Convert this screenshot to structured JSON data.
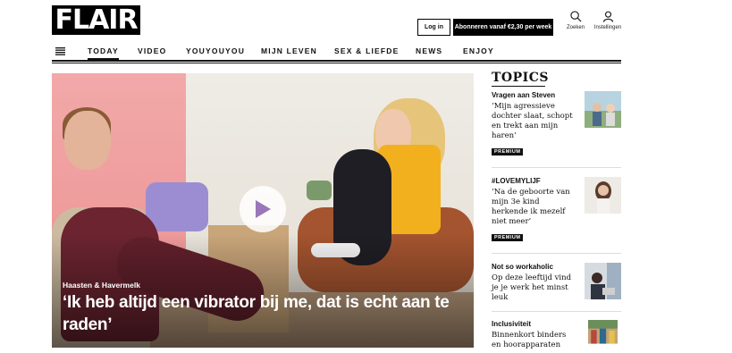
{
  "header": {
    "logo": "FLAIR",
    "login_label": "Log in",
    "subscribe_label": "Abonneren vanaf €2,30 per week",
    "search_label": "Zoeken",
    "settings_label": "Instellingen",
    "search_icon": "search-icon",
    "user_icon": "user-icon"
  },
  "nav": {
    "menu_icon": "hamburger-icon",
    "items": [
      "TODAY",
      "VIDEO",
      "YOUYOUYOU",
      "MIJN LEVEN",
      "SEX & LIEFDE",
      "NEWS",
      "ENJOY"
    ],
    "active": "TODAY"
  },
  "hero": {
    "kicker": "Haasten & Havermelk",
    "headline": "‘Ik heb altijd een vibrator bij me, dat is echt aan te raden’",
    "play_icon": "play-icon"
  },
  "topics": {
    "title": "Topics",
    "items": [
      {
        "kicker": "Vragen aan Steven",
        "title": "‘Mijn agressieve dochter slaat, schopt en trekt aan mijn haren’",
        "badge": "PREMIUM"
      },
      {
        "kicker": "#LOVEMYLIJF",
        "title": "‘Na de geboorte van mijn 3e kind herkende ik mezelf niet meer’",
        "badge": "PREMIUM"
      },
      {
        "kicker": "Not so workaholic",
        "title": "Op deze leeftijd vind je je werk het minst leuk",
        "badge": ""
      },
      {
        "kicker": "Inclusiviteit",
        "title": "Binnenkort binders en hoorapparaten",
        "badge": ""
      }
    ]
  },
  "colors": {
    "brand": "#000000",
    "badge": "#111111",
    "hero_pink": "#f2a9a9",
    "hero_yellow": "#f2b01e"
  }
}
